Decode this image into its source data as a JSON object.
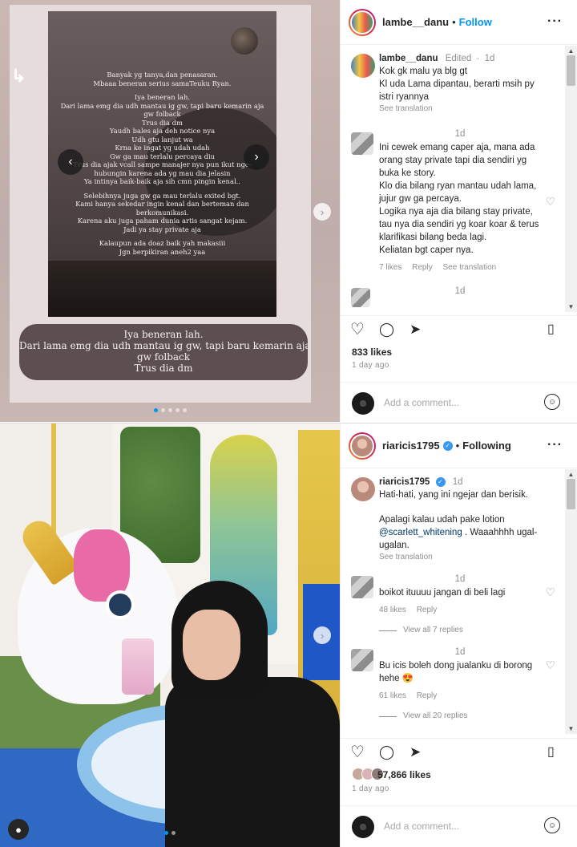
{
  "post1": {
    "username": "lambe__danu",
    "follow_label": "Follow",
    "image_lines": [
      "Banyak yg tanya,dan penasaran.",
      "Mbaaa beneran serius samaTeuku Ryan.",
      "",
      "Iya beneran lah.",
      "Dari lama emg dia udh mantau ig gw, tapi baru kemarin aja",
      "gw folback",
      "Trus dia dm",
      "Yaudh bales aja deh notice nya",
      "Udh gtu lanjut wa",
      "Krna ke ingat yg udah udah",
      "Gw ga mau terlalu percaya diu",
      "Trus dia ajak vcall sampe manajer nya pun ikut nge-",
      "hubungin karena ada yg mau dia jelasin",
      "Ya intinya baik-baik aja sih cmn pingin kenal..",
      "",
      "Selebihnya juga gw ga mau terlalu exited bgt.",
      "Kami hanya sekedar ingin kenal dan berteman dan",
      "berkomunikasi.",
      "Karena aku juga paham dunia artis sangat kejam.",
      "Jadi ya stay private aja",
      "",
      "Kalaupun ada doaz baik yah makasiii",
      "Jgn berpikiran aneh2 yaa"
    ],
    "zoom_lines": [
      "Iya beneran lah.",
      "Dari lama emg dia udh mantau ig gw, tapi baru kemarin aja",
      "gw folback",
      "Trus dia dm"
    ],
    "caption": {
      "username": "lambe__danu",
      "edited": "Edited",
      "time": "1d",
      "lines": [
        "Kok gk malu ya blg gt",
        "Kl uda Lama dipantau, berarti msih py istri ryannya"
      ],
      "see_translation": "See translation"
    },
    "comment": {
      "time": "1d",
      "paragraphs": [
        "Ini cewek emang caper aja, mana ada orang stay private tapi dia sendiri yg buka ke story.",
        "Klo dia bilang ryan mantau udah lama, jujur gw ga percaya.",
        "Logika nya aja dia bilang stay private, tau nya dia sendiri yg koar koar & terus klarifikasi bilang beda lagi.",
        "Keliatan bgt caper nya."
      ],
      "likes": "7 likes",
      "reply": "Reply",
      "see_translation": "See translation"
    },
    "next_comment_time": "1d",
    "likes": "833 likes",
    "ago": "1 day ago",
    "add_comment_placeholder": "Add a comment..."
  },
  "post2": {
    "username": "riaricis1795",
    "following_label": "Following",
    "caption": {
      "username": "riaricis1795",
      "time": "1d",
      "line1": "Hati-hati, yang ini ngejar dan berisik.",
      "line2_pre": "Apalagi kalau udah pake lotion",
      "mention": "@scarlett_whitening",
      "line2_post": ". Waaahhhh ugal-ugalan.",
      "see_translation": "See translation"
    },
    "comments": [
      {
        "time": "1d",
        "text": "boikot ituuuu jangan di beli lagi",
        "likes": "48 likes",
        "reply": "Reply",
        "view_replies": "View all 7 replies"
      },
      {
        "time": "1d",
        "text": "Bu icis boleh dong jualanku di borong hehe 😍",
        "likes": "61 likes",
        "reply": "Reply",
        "view_replies": "View all 20 replies"
      }
    ],
    "likes": "57,866 likes",
    "ago": "1 day ago",
    "add_comment_placeholder": "Add a comment..."
  },
  "icons": {
    "heart": "♡",
    "comment": "◯",
    "share": "➤",
    "save": "🔖",
    "more": "···",
    "chevron_left": "‹",
    "chevron_right": "›"
  },
  "colors": {
    "accent": "#0095f6",
    "text": "#262626",
    "muted": "#8e8e8e",
    "verified": "#3897f0"
  }
}
